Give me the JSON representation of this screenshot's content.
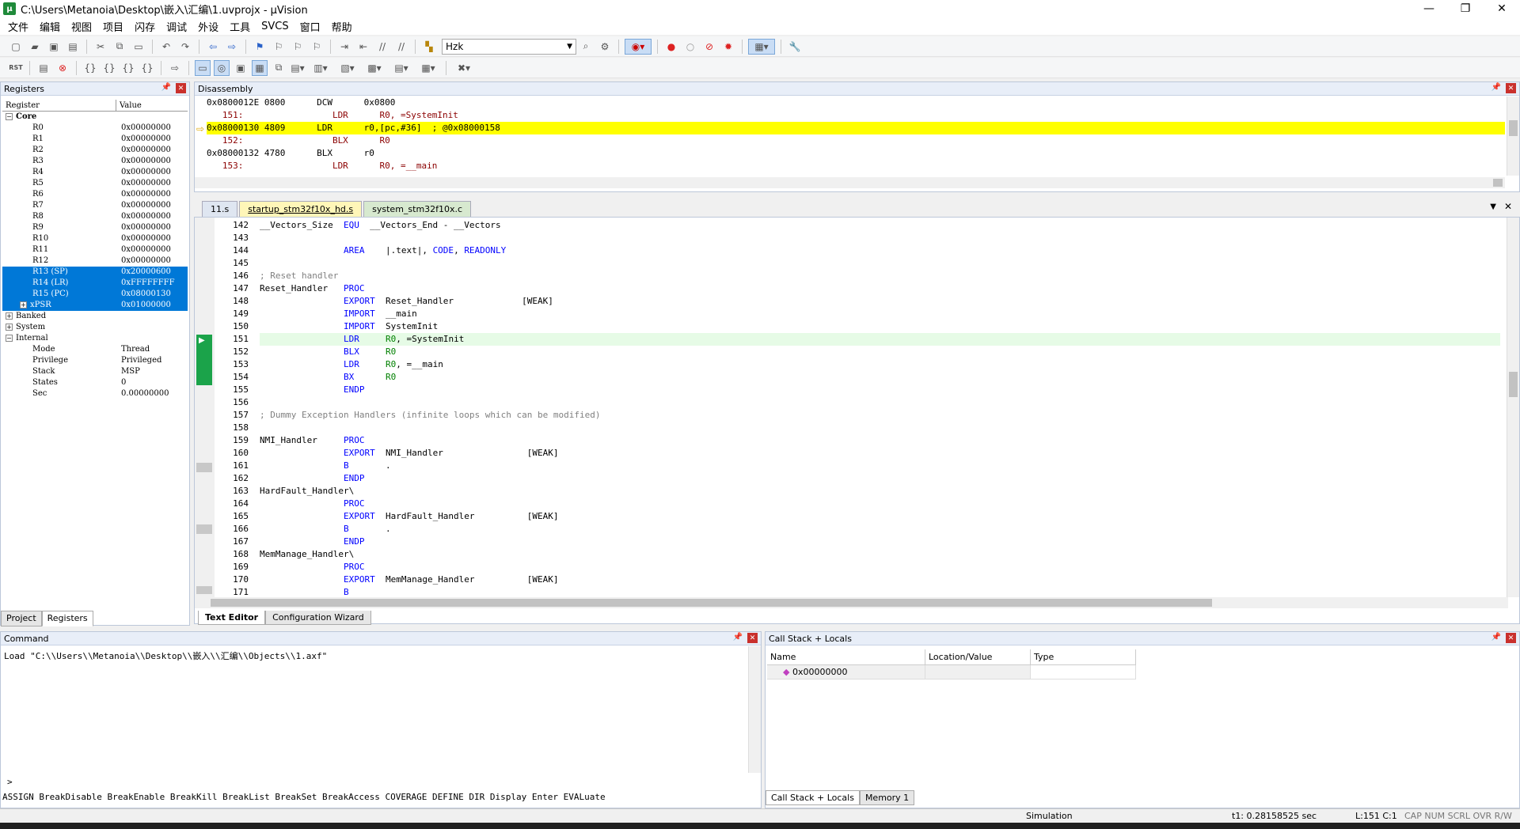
{
  "window": {
    "title": "C:\\Users\\Metanoia\\Desktop\\嵌入\\汇编\\1.uvprojx - µVision",
    "minimize": "—",
    "restore": "❐",
    "close": "✕"
  },
  "menu": [
    "文件",
    "编辑",
    "视图",
    "项目",
    "闪存",
    "调试",
    "外设",
    "工具",
    "SVCS",
    "窗口",
    "帮助"
  ],
  "toolbar": {
    "target_label": "Hzk"
  },
  "registers": {
    "title": "Registers",
    "col_register": "Register",
    "col_value": "Value",
    "groups": [
      {
        "name": "Core",
        "expanded": true,
        "items": [
          {
            "name": "R0",
            "value": "0x00000000"
          },
          {
            "name": "R1",
            "value": "0x00000000"
          },
          {
            "name": "R2",
            "value": "0x00000000"
          },
          {
            "name": "R3",
            "value": "0x00000000"
          },
          {
            "name": "R4",
            "value": "0x00000000"
          },
          {
            "name": "R5",
            "value": "0x00000000"
          },
          {
            "name": "R6",
            "value": "0x00000000"
          },
          {
            "name": "R7",
            "value": "0x00000000"
          },
          {
            "name": "R8",
            "value": "0x00000000"
          },
          {
            "name": "R9",
            "value": "0x00000000"
          },
          {
            "name": "R10",
            "value": "0x00000000"
          },
          {
            "name": "R11",
            "value": "0x00000000"
          },
          {
            "name": "R12",
            "value": "0x00000000"
          },
          {
            "name": "R13 (SP)",
            "value": "0x20000600",
            "selected": true
          },
          {
            "name": "R14 (LR)",
            "value": "0xFFFFFFFF",
            "selected": true
          },
          {
            "name": "R15 (PC)",
            "value": "0x08000130",
            "selected": true
          },
          {
            "name": "xPSR",
            "value": "0x01000000",
            "selected": true,
            "expandable": true
          }
        ]
      },
      {
        "name": "Banked",
        "expanded": false,
        "items": []
      },
      {
        "name": "System",
        "expanded": false,
        "items": []
      },
      {
        "name": "Internal",
        "expanded": true,
        "items": [
          {
            "name": "Mode",
            "value": "Thread"
          },
          {
            "name": "Privilege",
            "value": "Privileged"
          },
          {
            "name": "Stack",
            "value": "MSP"
          },
          {
            "name": "States",
            "value": "0"
          },
          {
            "name": "Sec",
            "value": "0.00000000"
          }
        ]
      }
    ],
    "tabs": [
      "Project",
      "Registers"
    ]
  },
  "disassembly": {
    "title": "Disassembly",
    "lines": [
      {
        "text": "0x0800012E 0800      DCW      0x0800",
        "type": "asm"
      },
      {
        "text": "   151:                 LDR      R0, =SystemInit",
        "type": "src"
      },
      {
        "text": "0x08000130 4809      LDR      r0,[pc,#36]  ; @0x08000158",
        "type": "cur"
      },
      {
        "text": "   152:                 BLX      R0",
        "type": "src"
      },
      {
        "text": "0x08000132 4780      BLX      r0",
        "type": "asm"
      },
      {
        "text": "   153:                 LDR      R0, =__main",
        "type": "src"
      }
    ]
  },
  "editor": {
    "tabs": [
      {
        "label": "11.s",
        "state": "normal"
      },
      {
        "label": "startup_stm32f10x_hd.s",
        "state": "active"
      },
      {
        "label": "system_stm32f10x.c",
        "state": "alt"
      }
    ],
    "lines": [
      {
        "n": "142",
        "t": [
          [
            "",
            "__Vectors_Size  "
          ],
          [
            "kw",
            "EQU"
          ],
          [
            "",
            "  __Vectors_End - __Vectors"
          ]
        ]
      },
      {
        "n": "143",
        "t": []
      },
      {
        "n": "144",
        "t": [
          [
            "",
            "                "
          ],
          [
            "kw",
            "AREA"
          ],
          [
            "",
            "    |.text|, "
          ],
          [
            "kw",
            "CODE"
          ],
          [
            "",
            ", "
          ],
          [
            "kw",
            "READONLY"
          ]
        ]
      },
      {
        "n": "145",
        "t": []
      },
      {
        "n": "146",
        "t": [
          [
            "cm",
            "; Reset handler"
          ]
        ]
      },
      {
        "n": "147",
        "t": [
          [
            "",
            "Reset_Handler   "
          ],
          [
            "kw",
            "PROC"
          ]
        ]
      },
      {
        "n": "148",
        "t": [
          [
            "",
            "                "
          ],
          [
            "kw",
            "EXPORT"
          ],
          [
            "",
            "  Reset_Handler             [WEAK]"
          ]
        ]
      },
      {
        "n": "149",
        "t": [
          [
            "",
            "                "
          ],
          [
            "kw",
            "IMPORT"
          ],
          [
            "",
            "  __main"
          ]
        ]
      },
      {
        "n": "150",
        "t": [
          [
            "",
            "                "
          ],
          [
            "kw",
            "IMPORT"
          ],
          [
            "",
            "  SystemInit"
          ]
        ]
      },
      {
        "n": "151",
        "t": [
          [
            "",
            "                "
          ],
          [
            "kw",
            "LDR"
          ],
          [
            "",
            "     "
          ],
          [
            "gr",
            "R0"
          ],
          [
            "",
            ", =SystemInit"
          ]
        ],
        "hl": true
      },
      {
        "n": "152",
        "t": [
          [
            "",
            "                "
          ],
          [
            "kw",
            "BLX"
          ],
          [
            "",
            "     "
          ],
          [
            "gr",
            "R0"
          ]
        ]
      },
      {
        "n": "153",
        "t": [
          [
            "",
            "                "
          ],
          [
            "kw",
            "LDR"
          ],
          [
            "",
            "     "
          ],
          [
            "gr",
            "R0"
          ],
          [
            "",
            ", =__main"
          ]
        ]
      },
      {
        "n": "154",
        "t": [
          [
            "",
            "                "
          ],
          [
            "kw",
            "BX"
          ],
          [
            "",
            "      "
          ],
          [
            "gr",
            "R0"
          ]
        ]
      },
      {
        "n": "155",
        "t": [
          [
            "",
            "                "
          ],
          [
            "kw",
            "ENDP"
          ]
        ]
      },
      {
        "n": "156",
        "t": []
      },
      {
        "n": "157",
        "t": [
          [
            "cm",
            "; Dummy Exception Handlers (infinite loops which can be modified)"
          ]
        ]
      },
      {
        "n": "158",
        "t": []
      },
      {
        "n": "159",
        "t": [
          [
            "",
            "NMI_Handler     "
          ],
          [
            "kw",
            "PROC"
          ]
        ]
      },
      {
        "n": "160",
        "t": [
          [
            "",
            "                "
          ],
          [
            "kw",
            "EXPORT"
          ],
          [
            "",
            "  NMI_Handler                [WEAK]"
          ]
        ]
      },
      {
        "n": "161",
        "t": [
          [
            "",
            "                "
          ],
          [
            "kw",
            "B"
          ],
          [
            "",
            "       ."
          ]
        ]
      },
      {
        "n": "162",
        "t": [
          [
            "",
            "                "
          ],
          [
            "kw",
            "ENDP"
          ]
        ]
      },
      {
        "n": "163",
        "t": [
          [
            "",
            "HardFault_Handler\\"
          ]
        ]
      },
      {
        "n": "164",
        "t": [
          [
            "",
            "                "
          ],
          [
            "kw",
            "PROC"
          ]
        ]
      },
      {
        "n": "165",
        "t": [
          [
            "",
            "                "
          ],
          [
            "kw",
            "EXPORT"
          ],
          [
            "",
            "  HardFault_Handler          [WEAK]"
          ]
        ]
      },
      {
        "n": "166",
        "t": [
          [
            "",
            "                "
          ],
          [
            "kw",
            "B"
          ],
          [
            "",
            "       ."
          ]
        ]
      },
      {
        "n": "167",
        "t": [
          [
            "",
            "                "
          ],
          [
            "kw",
            "ENDP"
          ]
        ]
      },
      {
        "n": "168",
        "t": [
          [
            "",
            "MemManage_Handler\\"
          ]
        ]
      },
      {
        "n": "169",
        "t": [
          [
            "",
            "                "
          ],
          [
            "kw",
            "PROC"
          ]
        ]
      },
      {
        "n": "170",
        "t": [
          [
            "",
            "                "
          ],
          [
            "kw",
            "EXPORT"
          ],
          [
            "",
            "  MemManage_Handler          [WEAK]"
          ]
        ]
      },
      {
        "n": "171",
        "t": [
          [
            "",
            "                "
          ],
          [
            "kw",
            "B"
          ]
        ]
      }
    ],
    "bottom_tabs": [
      "Text Editor",
      "Configuration Wizard"
    ]
  },
  "command": {
    "title": "Command",
    "output": "Load \"C:\\\\Users\\\\Metanoia\\\\Desktop\\\\嵌入\\\\汇编\\\\Objects\\\\1.axf\"",
    "prompt": ">",
    "hints": "ASSIGN BreakDisable BreakEnable BreakKill BreakList BreakSet BreakAccess COVERAGE DEFINE DIR Display Enter EVALuate"
  },
  "callstack": {
    "title": "Call Stack + Locals",
    "col_name": "Name",
    "col_location": "Location/Value",
    "col_type": "Type",
    "row_name": "0x00000000",
    "tabs": [
      "Call Stack + Locals",
      "Memory 1"
    ]
  },
  "status": {
    "mode": "Simulation",
    "time": "t1: 0.28158525 sec",
    "pos": "L:151 C:1",
    "flags": "CAP  NUM  SCRL  OVR  R/W"
  }
}
